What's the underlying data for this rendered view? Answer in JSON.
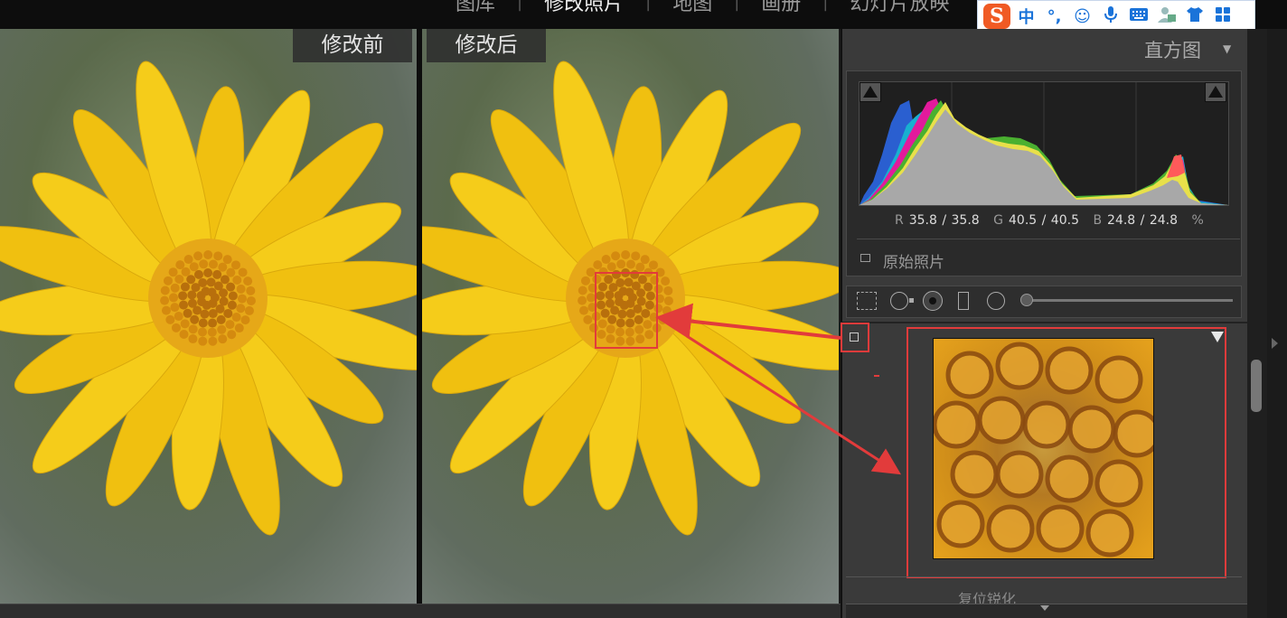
{
  "modules": {
    "items": [
      "图库",
      "修改照片",
      "地图",
      "画册",
      "幻灯片放映"
    ],
    "active": "修改照片"
  },
  "ime": {
    "logo": "S",
    "items": [
      "中",
      "°,",
      "☺",
      "mic-icon",
      "keyboard-icon",
      "user-icon",
      "shirt-icon",
      "grid-icon"
    ]
  },
  "view": {
    "before_label": "修改前",
    "after_label": "修改后"
  },
  "panel": {
    "histogram_title": "直方图",
    "readout": {
      "r_label": "R",
      "r_value": "35.8 / 35.8",
      "g_label": "G",
      "g_value": "40.5 / 40.5",
      "b_label": "B",
      "b_value": "24.8 / 24.8",
      "unit": "%"
    },
    "original_photo_label": "原始照片",
    "detail_section_label": "复位锐化"
  },
  "colors": {
    "annotation": "#e23b3b",
    "flower": "#f5cc1a",
    "flower_center": "#d48a0f",
    "panel_bg": "#3a3a3a"
  }
}
